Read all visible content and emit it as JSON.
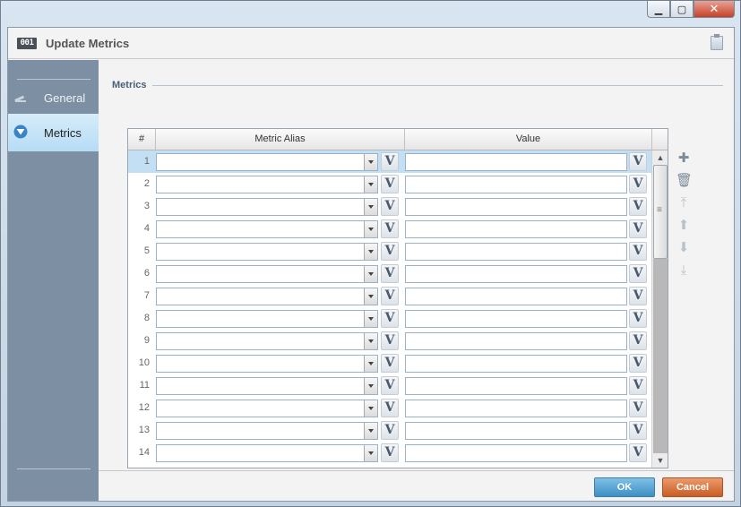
{
  "window": {
    "minimize_glyph": "▁",
    "maximize_glyph": "▢",
    "close_glyph": "✕"
  },
  "header": {
    "icon_text": "001",
    "title": "Update Metrics"
  },
  "sidebar": {
    "items": [
      {
        "label": "General",
        "icon": "pencil-icon",
        "active": false
      },
      {
        "label": "Metrics",
        "icon": "funnel-icon",
        "active": true
      }
    ]
  },
  "section": {
    "legend": "Metrics"
  },
  "grid": {
    "columns": [
      "#",
      "Metric Alias",
      "Value"
    ],
    "rows": [
      {
        "num": "1",
        "alias": "",
        "value": "",
        "selected": true
      },
      {
        "num": "2",
        "alias": "",
        "value": ""
      },
      {
        "num": "3",
        "alias": "",
        "value": ""
      },
      {
        "num": "4",
        "alias": "",
        "value": ""
      },
      {
        "num": "5",
        "alias": "",
        "value": ""
      },
      {
        "num": "6",
        "alias": "",
        "value": ""
      },
      {
        "num": "7",
        "alias": "",
        "value": ""
      },
      {
        "num": "8",
        "alias": "",
        "value": ""
      },
      {
        "num": "9",
        "alias": "",
        "value": ""
      },
      {
        "num": "10",
        "alias": "",
        "value": ""
      },
      {
        "num": "11",
        "alias": "",
        "value": ""
      },
      {
        "num": "12",
        "alias": "",
        "value": ""
      },
      {
        "num": "13",
        "alias": "",
        "value": ""
      },
      {
        "num": "14",
        "alias": "",
        "value": ""
      }
    ],
    "variable_button_label": "V",
    "scroll_up_glyph": "▲",
    "scroll_down_glyph": "▼"
  },
  "tools": [
    {
      "name": "add-row-icon",
      "glyph": "✚"
    },
    {
      "name": "delete-row-icon",
      "glyph": "🗑"
    },
    {
      "name": "move-top-icon",
      "glyph": "⤒"
    },
    {
      "name": "move-up-icon",
      "glyph": "⬆"
    },
    {
      "name": "move-down-icon",
      "glyph": "⬇"
    },
    {
      "name": "move-bottom-icon",
      "glyph": "⤓"
    }
  ],
  "footer": {
    "ok_label": "OK",
    "cancel_label": "Cancel"
  },
  "colors": {
    "sidebar_bg": "#7d8fa3",
    "active_item": "#c3e2f7",
    "ok": "#4f9fd2",
    "cancel": "#d86f34"
  }
}
